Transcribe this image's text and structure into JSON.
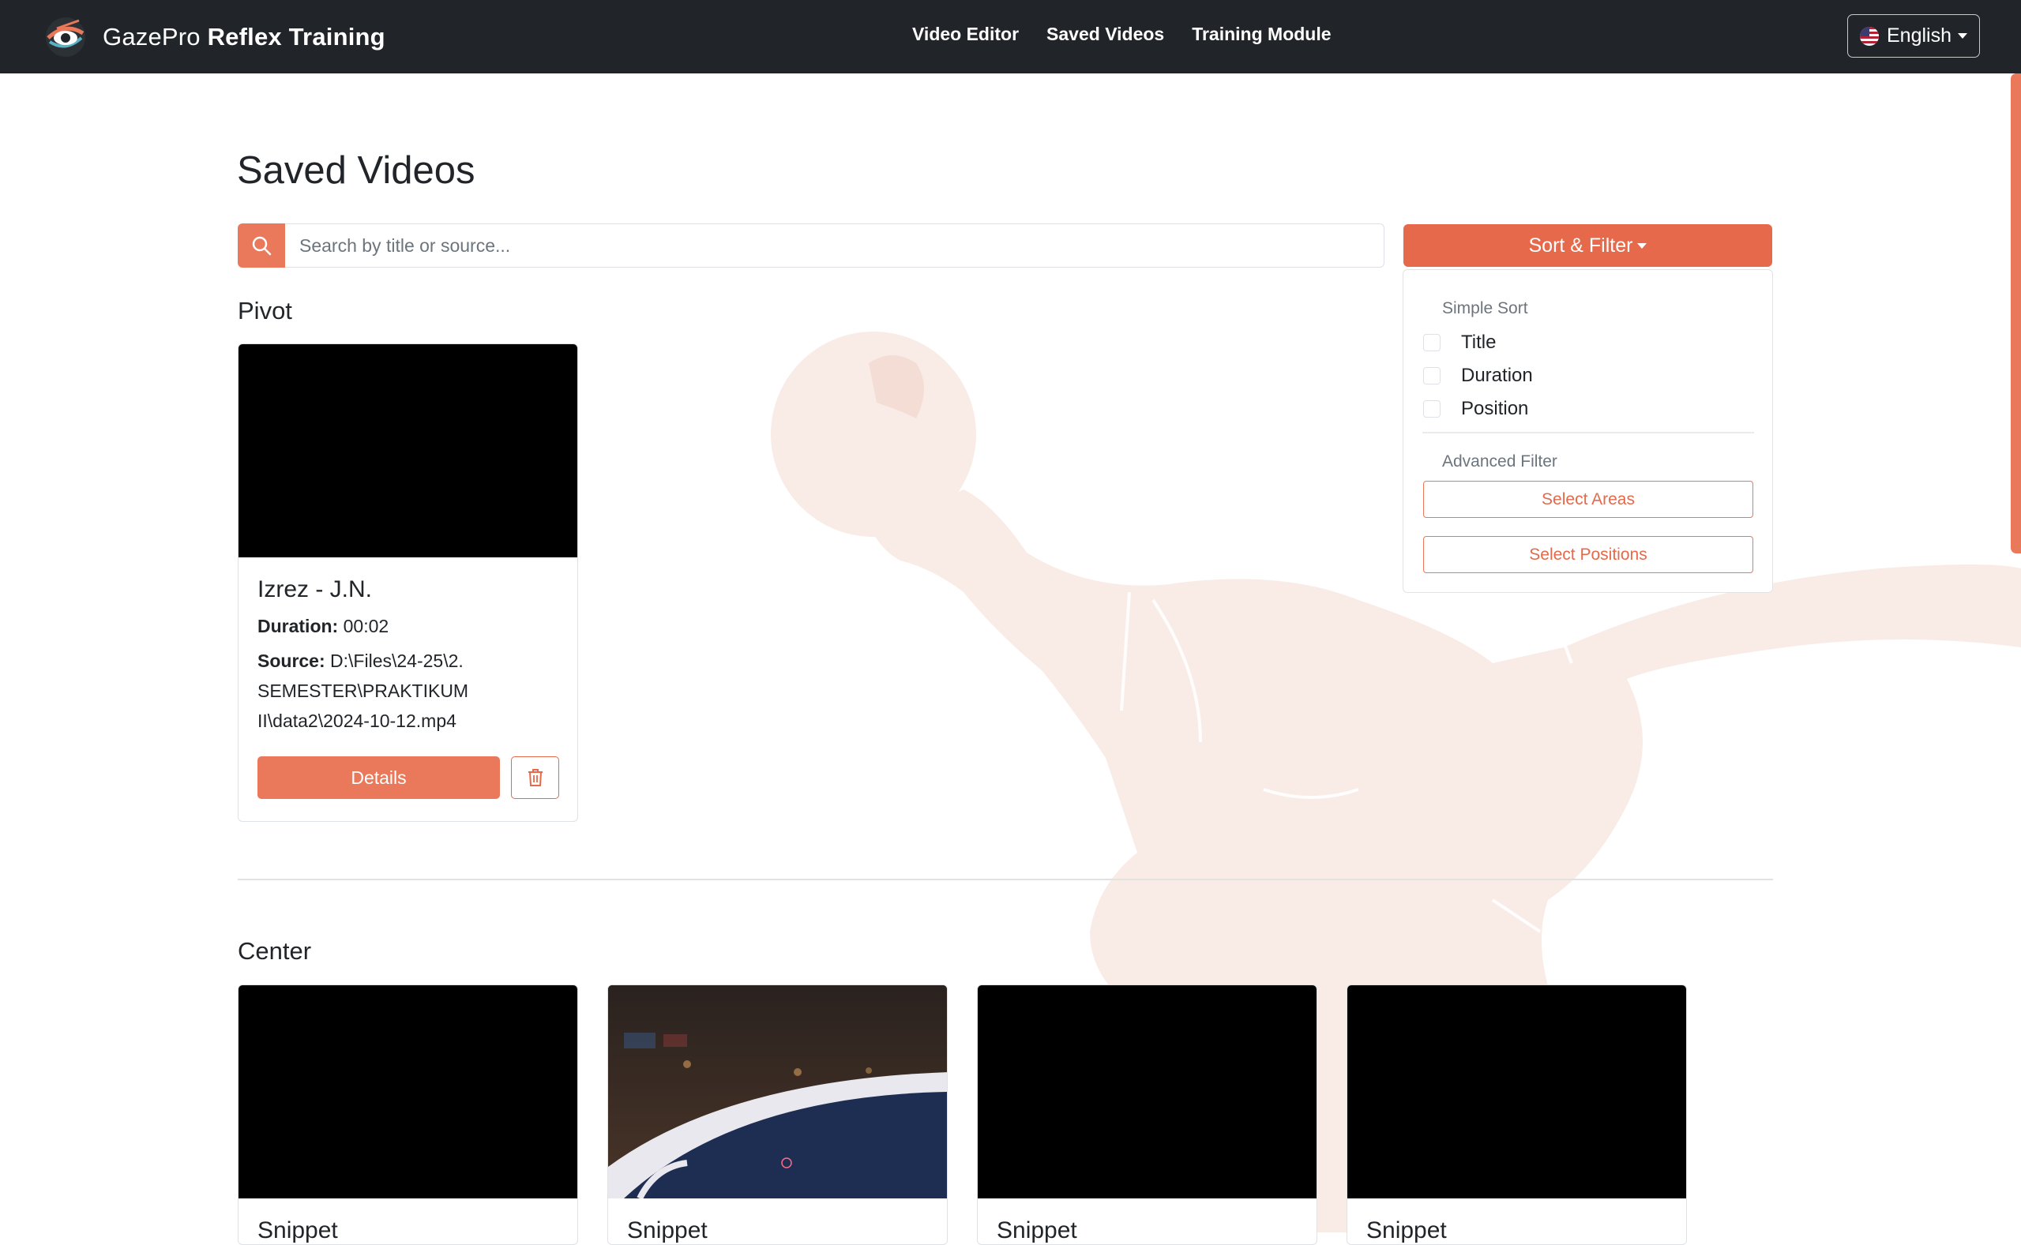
{
  "brand": {
    "name_light": "GazePro",
    "name_bold": "Reflex Training",
    "logo_icon": "eye-logo-icon"
  },
  "nav": {
    "links": [
      "Video Editor",
      "Saved Videos",
      "Training Module"
    ]
  },
  "language": {
    "label": "English",
    "flag_icon": "us-flag-icon"
  },
  "page": {
    "title": "Saved Videos"
  },
  "search": {
    "placeholder": "Search by title or source...",
    "value": "",
    "icon": "search-icon"
  },
  "sort_filter": {
    "button_label": "Sort & Filter",
    "simple_sort_header": "Simple Sort",
    "options": [
      "Title",
      "Duration",
      "Position"
    ],
    "advanced_filter_header": "Advanced Filter",
    "select_areas_label": "Select Areas",
    "select_positions_label": "Select Positions"
  },
  "sections": {
    "pivot": {
      "title": "Pivot",
      "card": {
        "title": "Izrez - J.N.",
        "duration_label": "Duration:",
        "duration": "00:02",
        "source_label": "Source:",
        "source_line1": "D:\\Files\\24-25\\2.",
        "source_line2": "SEMESTER\\PRAKTIKUM",
        "source_line3": "II\\data2\\2024-10-12.mp4",
        "details_label": "Details",
        "delete_icon": "trash-icon"
      }
    },
    "center": {
      "title": "Center",
      "cards": [
        {
          "title": "Snippet"
        },
        {
          "title": "Snippet"
        },
        {
          "title": "Snippet"
        },
        {
          "title": "Snippet"
        }
      ]
    }
  },
  "colors": {
    "accent": "#e9795a",
    "accent_dark": "#e5694a",
    "navbar": "#212529",
    "bg_figure": "#f9ece7"
  }
}
